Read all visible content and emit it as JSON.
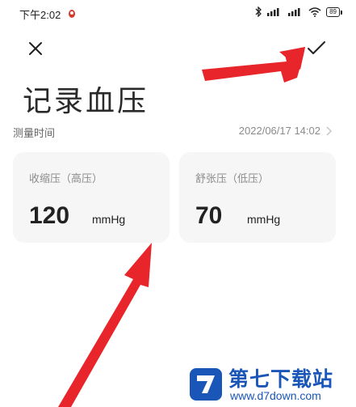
{
  "status_bar": {
    "time": "下午2:02",
    "battery": "89"
  },
  "header": {
    "close_icon": "close-icon",
    "confirm_icon": "check-icon",
    "title": "记录血压"
  },
  "measure_time": {
    "label": "测量时间",
    "value": "2022/06/17 14:02"
  },
  "cards": {
    "systolic": {
      "label": "收缩压（高压）",
      "value": "120",
      "unit": "mmHg"
    },
    "diastolic": {
      "label": "舒张压（低压）",
      "value": "70",
      "unit": "mmHg"
    }
  },
  "watermark": {
    "title": "第七下载站",
    "url": "www.d7down.com"
  },
  "colors": {
    "annotation_arrow": "#e8252a",
    "card_bg": "#f6f6f6",
    "watermark_blue": "#1a56b8"
  }
}
